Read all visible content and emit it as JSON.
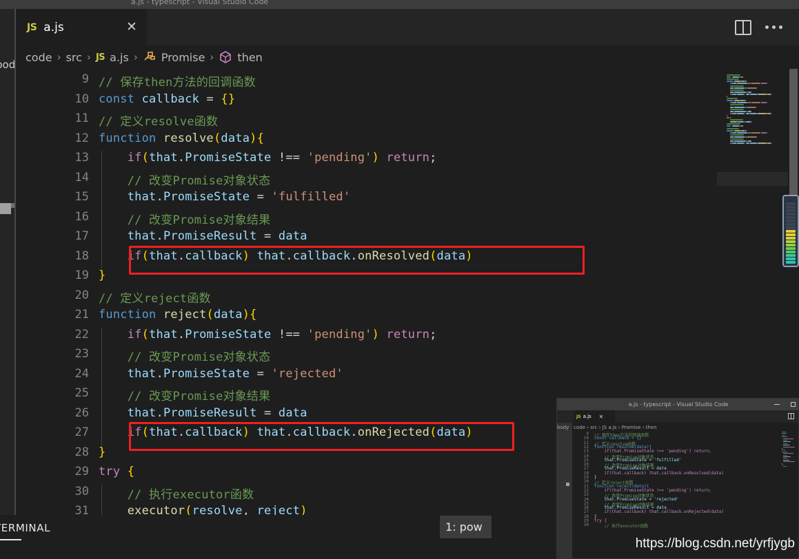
{
  "window": {
    "titlebar_ghost_text": "a.js - typescript - Visual Studio Code"
  },
  "left_strip": {
    "ghost_label": "body"
  },
  "tab": {
    "file_icon": "JS",
    "label": "a.js",
    "close_icon": "✕",
    "split_editor_icon": "split-editor-icon",
    "more_actions_icon": "ellipsis-icon"
  },
  "breadcrumb": {
    "items": [
      {
        "label": "code",
        "icon": null
      },
      {
        "label": "src",
        "icon": null
      },
      {
        "label": "a.js",
        "icon": "JS"
      },
      {
        "label": "Promise",
        "icon": "method-icon"
      },
      {
        "label": "then",
        "icon": "cube-icon"
      }
    ],
    "separator": "›"
  },
  "editor": {
    "first_line_number": 9,
    "line_numbers": [
      9,
      10,
      11,
      12,
      13,
      14,
      15,
      16,
      17,
      18,
      19,
      20,
      21,
      22,
      23,
      24,
      25,
      26,
      27,
      28,
      29,
      30,
      31
    ],
    "lines": [
      {
        "n": 9,
        "tokens": [
          {
            "t": "// 保存then方法的回调函数",
            "c": "t-com"
          }
        ]
      },
      {
        "n": 10,
        "tokens": [
          {
            "t": "const",
            "c": "t-key"
          },
          {
            "t": " ",
            "c": "t-pun"
          },
          {
            "t": "callback",
            "c": "t-var"
          },
          {
            "t": " = ",
            "c": "t-op"
          },
          {
            "t": "{}",
            "c": "t-br1"
          }
        ]
      },
      {
        "n": 11,
        "tokens": [
          {
            "t": "// 定义resolve函数",
            "c": "t-com"
          }
        ]
      },
      {
        "n": 12,
        "tokens": [
          {
            "t": "function",
            "c": "t-key"
          },
          {
            "t": " ",
            "c": "t-pun"
          },
          {
            "t": "resolve",
            "c": "t-fn"
          },
          {
            "t": "(",
            "c": "t-br1"
          },
          {
            "t": "data",
            "c": "t-var"
          },
          {
            "t": ")",
            "c": "t-br1"
          },
          {
            "t": "{",
            "c": "t-br1"
          }
        ]
      },
      {
        "n": 13,
        "tokens": [
          {
            "t": "    ",
            "c": "t-pun"
          },
          {
            "t": "if",
            "c": "t-key2"
          },
          {
            "t": "(",
            "c": "t-br1"
          },
          {
            "t": "that",
            "c": "t-var"
          },
          {
            "t": ".",
            "c": "t-pun"
          },
          {
            "t": "PromiseState",
            "c": "t-var"
          },
          {
            "t": " !== ",
            "c": "t-op"
          },
          {
            "t": "'pending'",
            "c": "t-str"
          },
          {
            "t": ")",
            "c": "t-br1"
          },
          {
            "t": " ",
            "c": "t-pun"
          },
          {
            "t": "return",
            "c": "t-key2"
          },
          {
            "t": ";",
            "c": "t-pun"
          }
        ]
      },
      {
        "n": 14,
        "tokens": [
          {
            "t": "    ",
            "c": "t-pun"
          },
          {
            "t": "// 改变Promise对象状态",
            "c": "t-com"
          }
        ]
      },
      {
        "n": 15,
        "tokens": [
          {
            "t": "    ",
            "c": "t-pun"
          },
          {
            "t": "that",
            "c": "t-var"
          },
          {
            "t": ".",
            "c": "t-pun"
          },
          {
            "t": "PromiseState",
            "c": "t-var"
          },
          {
            "t": " = ",
            "c": "t-op"
          },
          {
            "t": "'fulfilled'",
            "c": "t-str"
          }
        ]
      },
      {
        "n": 16,
        "tokens": [
          {
            "t": "    ",
            "c": "t-pun"
          },
          {
            "t": "// 改变Promise对象结果",
            "c": "t-com"
          }
        ]
      },
      {
        "n": 17,
        "tokens": [
          {
            "t": "    ",
            "c": "t-pun"
          },
          {
            "t": "that",
            "c": "t-var"
          },
          {
            "t": ".",
            "c": "t-pun"
          },
          {
            "t": "PromiseResult",
            "c": "t-var"
          },
          {
            "t": " = ",
            "c": "t-op"
          },
          {
            "t": "data",
            "c": "t-var"
          }
        ]
      },
      {
        "n": 18,
        "tokens": [
          {
            "t": "    ",
            "c": "t-pun"
          },
          {
            "t": "if",
            "c": "t-key2"
          },
          {
            "t": "(",
            "c": "t-br1"
          },
          {
            "t": "that",
            "c": "t-var"
          },
          {
            "t": ".",
            "c": "t-pun"
          },
          {
            "t": "callback",
            "c": "t-var"
          },
          {
            "t": ")",
            "c": "t-br1"
          },
          {
            "t": " ",
            "c": "t-pun"
          },
          {
            "t": "that",
            "c": "t-var"
          },
          {
            "t": ".",
            "c": "t-pun"
          },
          {
            "t": "callback",
            "c": "t-var"
          },
          {
            "t": ".",
            "c": "t-pun"
          },
          {
            "t": "onResolved",
            "c": "t-fn"
          },
          {
            "t": "(",
            "c": "t-br1"
          },
          {
            "t": "data",
            "c": "t-var"
          },
          {
            "t": ")",
            "c": "t-br1"
          }
        ]
      },
      {
        "n": 19,
        "tokens": [
          {
            "t": "}",
            "c": "t-br1"
          }
        ]
      },
      {
        "n": 20,
        "tokens": [
          {
            "t": "// 定义reject函数",
            "c": "t-com"
          }
        ]
      },
      {
        "n": 21,
        "tokens": [
          {
            "t": "function",
            "c": "t-key"
          },
          {
            "t": " ",
            "c": "t-pun"
          },
          {
            "t": "reject",
            "c": "t-fn"
          },
          {
            "t": "(",
            "c": "t-br1"
          },
          {
            "t": "data",
            "c": "t-var"
          },
          {
            "t": ")",
            "c": "t-br1"
          },
          {
            "t": "{",
            "c": "t-br1"
          }
        ]
      },
      {
        "n": 22,
        "tokens": [
          {
            "t": "    ",
            "c": "t-pun"
          },
          {
            "t": "if",
            "c": "t-key2"
          },
          {
            "t": "(",
            "c": "t-br1"
          },
          {
            "t": "that",
            "c": "t-var"
          },
          {
            "t": ".",
            "c": "t-pun"
          },
          {
            "t": "PromiseState",
            "c": "t-var"
          },
          {
            "t": " !== ",
            "c": "t-op"
          },
          {
            "t": "'pending'",
            "c": "t-str"
          },
          {
            "t": ")",
            "c": "t-br1"
          },
          {
            "t": " ",
            "c": "t-pun"
          },
          {
            "t": "return",
            "c": "t-key2"
          },
          {
            "t": ";",
            "c": "t-pun"
          }
        ]
      },
      {
        "n": 23,
        "tokens": [
          {
            "t": "    ",
            "c": "t-pun"
          },
          {
            "t": "// 改变Promise对象状态",
            "c": "t-com"
          }
        ]
      },
      {
        "n": 24,
        "tokens": [
          {
            "t": "    ",
            "c": "t-pun"
          },
          {
            "t": "that",
            "c": "t-var"
          },
          {
            "t": ".",
            "c": "t-pun"
          },
          {
            "t": "PromiseState",
            "c": "t-var"
          },
          {
            "t": " = ",
            "c": "t-op"
          },
          {
            "t": "'rejected'",
            "c": "t-str"
          }
        ]
      },
      {
        "n": 25,
        "tokens": [
          {
            "t": "    ",
            "c": "t-pun"
          },
          {
            "t": "// 改变Promise对象结果",
            "c": "t-com"
          }
        ]
      },
      {
        "n": 26,
        "tokens": [
          {
            "t": "    ",
            "c": "t-pun"
          },
          {
            "t": "that",
            "c": "t-var"
          },
          {
            "t": ".",
            "c": "t-pun"
          },
          {
            "t": "PromiseResult",
            "c": "t-var"
          },
          {
            "t": " = ",
            "c": "t-op"
          },
          {
            "t": "data",
            "c": "t-var"
          }
        ]
      },
      {
        "n": 27,
        "tokens": [
          {
            "t": "    ",
            "c": "t-pun"
          },
          {
            "t": "if",
            "c": "t-key2"
          },
          {
            "t": "(",
            "c": "t-br1"
          },
          {
            "t": "that",
            "c": "t-var"
          },
          {
            "t": ".",
            "c": "t-pun"
          },
          {
            "t": "callback",
            "c": "t-var"
          },
          {
            "t": ")",
            "c": "t-br1"
          },
          {
            "t": " ",
            "c": "t-pun"
          },
          {
            "t": "that",
            "c": "t-var"
          },
          {
            "t": ".",
            "c": "t-pun"
          },
          {
            "t": "callback",
            "c": "t-var"
          },
          {
            "t": ".",
            "c": "t-pun"
          },
          {
            "t": "onRejected",
            "c": "t-fn"
          },
          {
            "t": "(",
            "c": "t-br1"
          },
          {
            "t": "data",
            "c": "t-var"
          },
          {
            "t": ")",
            "c": "t-br1"
          }
        ]
      },
      {
        "n": 28,
        "tokens": [
          {
            "t": "}",
            "c": "t-br1"
          }
        ]
      },
      {
        "n": 29,
        "tokens": [
          {
            "t": "try",
            "c": "t-key2"
          },
          {
            "t": " ",
            "c": "t-pun"
          },
          {
            "t": "{",
            "c": "t-br1"
          }
        ]
      },
      {
        "n": 30,
        "tokens": [
          {
            "t": "    ",
            "c": "t-pun"
          },
          {
            "t": "// 执行executor函数",
            "c": "t-com"
          }
        ]
      },
      {
        "n": 31,
        "tokens": [
          {
            "t": "    ",
            "c": "t-pun"
          },
          {
            "t": "executor",
            "c": "t-fn"
          },
          {
            "t": "(",
            "c": "t-br1"
          },
          {
            "t": "resolve",
            "c": "t-var"
          },
          {
            "t": ", ",
            "c": "t-pun"
          },
          {
            "t": "reject",
            "c": "t-var"
          },
          {
            "t": ")",
            "c": "t-br1"
          }
        ]
      }
    ]
  },
  "annotations": {
    "color": "#f02020",
    "boxes": [
      {
        "name": "onresolved-highlight",
        "line": 18
      },
      {
        "name": "onrejected-highlight",
        "line": 27
      }
    ]
  },
  "panel": {
    "active_tab": "TERMINAL",
    "terminal_select_value": "1: pow"
  },
  "thumbnail": {
    "title": "a.js - typescript - Visual Studio Code",
    "minimize_icon": "minimize-icon",
    "maximize_icon": "maximize-icon",
    "tab_icon": "JS",
    "tab_label": "a.js",
    "tab_close": "✕",
    "split_icon": "split-editor-icon",
    "breadcrumb_left_ghost": "body",
    "breadcrumb": "code › src › JS a.js › Promise › then",
    "lines": [
      {
        "n": 9,
        "text": "// 保存then方法的回调函数"
      },
      {
        "n": 10,
        "text": "const callback = {}"
      },
      {
        "n": 11,
        "text": "// 定义resolve函数"
      },
      {
        "n": 12,
        "text": "function resolve(data){"
      },
      {
        "n": 13,
        "text": "    if(that.PromiseState !== 'pending') return;"
      },
      {
        "n": 14,
        "text": "    // 改变Promise对象状态"
      },
      {
        "n": 15,
        "text": "    that.PromiseState = 'fulfilled'"
      },
      {
        "n": 16,
        "text": "    // 改变Promise对象结果"
      },
      {
        "n": 17,
        "text": "    that.PromiseResult = data"
      },
      {
        "n": 18,
        "text": "    if(that.callback) that.callback.onResolved(data)"
      },
      {
        "n": 19,
        "text": "}"
      },
      {
        "n": 20,
        "text": "// 定义reject函数"
      },
      {
        "n": 21,
        "text": "function reject(data){"
      },
      {
        "n": 22,
        "text": "    if(that.PromiseState !== 'pending') return;"
      },
      {
        "n": 23,
        "text": "    // 改变Promise对象状态"
      },
      {
        "n": 24,
        "text": "    that.PromiseState = 'rejected'"
      },
      {
        "n": 25,
        "text": "    // 改变Promise对象结果"
      },
      {
        "n": 26,
        "text": "    that.PromiseResult = data"
      },
      {
        "n": 27,
        "text": "    if(that.callback) that.callback.onRejected(data)"
      },
      {
        "n": 28,
        "text": "}"
      },
      {
        "n": 29,
        "text": "try {"
      },
      {
        "n": 30,
        "text": "    // 执行executor函数"
      }
    ]
  },
  "watermark": {
    "text": "https://blog.csdn.net/yrfjygb"
  },
  "colors": {
    "editor_background": "#1e1e1e",
    "chrome_background": "#252526",
    "titlebar_background": "#3c3c3c",
    "annotation_red": "#f02020",
    "comment_green": "#6a9955",
    "keyword_blue": "#569cd6",
    "control_purple": "#c586c0",
    "variable_lightblue": "#9cdcfe",
    "function_yellow": "#dcdcaa",
    "string_orange": "#ce9178",
    "line_number_gray": "#858585"
  }
}
